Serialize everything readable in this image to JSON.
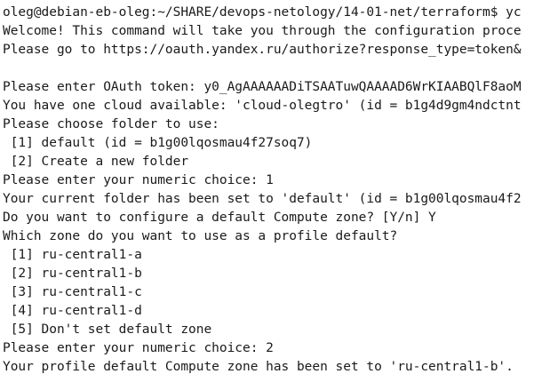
{
  "terminal": {
    "lines": [
      "oleg@debian-eb-oleg:~/SHARE/devops-netology/14-01-net/terraform$ yc",
      "Welcome! This command will take you through the configuration proce",
      "Please go to https://oauth.yandex.ru/authorize?response_type=token&",
      "",
      "Please enter OAuth token: y0_AgAAAAAADiTSAATuwQAAAAD6WrKIAABQlF8aoM",
      "You have one cloud available: 'cloud-olegtro' (id = b1g4d9gm4ndctnt",
      "Please choose folder to use:",
      " [1] default (id = b1g00lqosmau4f27soq7)",
      " [2] Create a new folder",
      "Please enter your numeric choice: 1",
      "Your current folder has been set to 'default' (id = b1g00lqosmau4f2",
      "Do you want to configure a default Compute zone? [Y/n] Y",
      "Which zone do you want to use as a profile default?",
      " [1] ru-central1-a",
      " [2] ru-central1-b",
      " [3] ru-central1-c",
      " [4] ru-central1-d",
      " [5] Don't set default zone",
      "Please enter your numeric choice: 2",
      "Your profile default Compute zone has been set to 'ru-central1-b'."
    ]
  }
}
